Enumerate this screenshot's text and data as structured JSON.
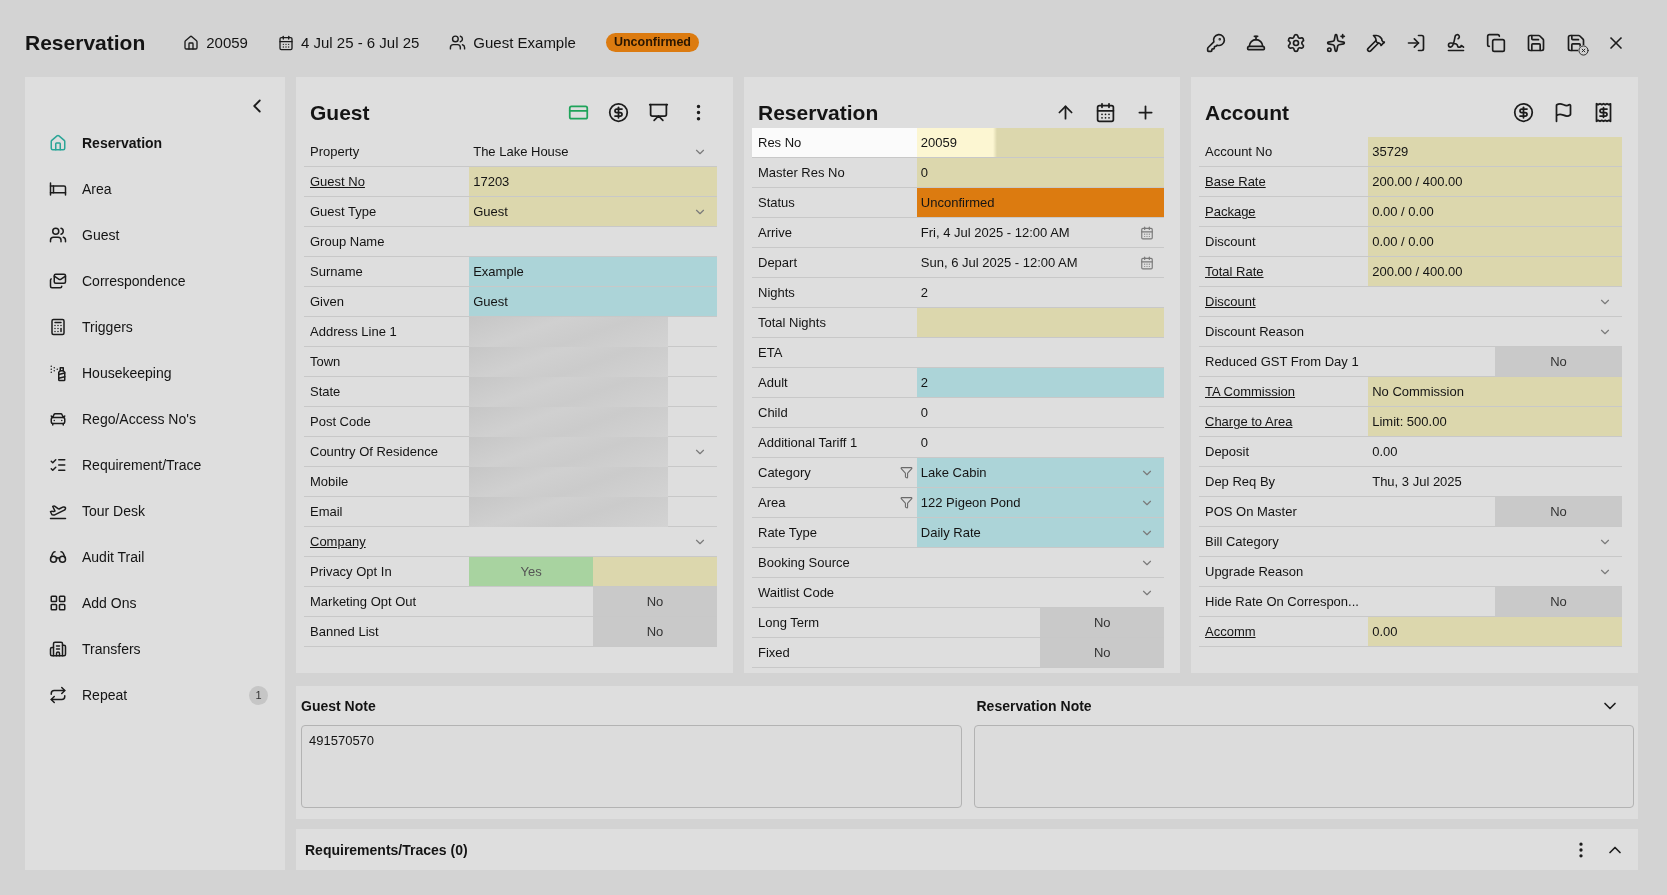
{
  "header": {
    "title": "Reservation",
    "reservation_no": "20059",
    "dates": "4 Jul 25 - 6 Jul 25",
    "guest": "Guest Example",
    "status": "Unconfirmed"
  },
  "sidebar": {
    "items": [
      {
        "label": "Reservation",
        "selected": true
      },
      {
        "label": "Area",
        "selected": false
      },
      {
        "label": "Guest",
        "selected": false
      },
      {
        "label": "Correspondence",
        "selected": false
      },
      {
        "label": "Triggers",
        "selected": false
      },
      {
        "label": "Housekeeping",
        "selected": false
      },
      {
        "label": "Rego/Access No's",
        "selected": false
      },
      {
        "label": "Requirement/Trace",
        "selected": false
      },
      {
        "label": "Tour Desk",
        "selected": false
      },
      {
        "label": "Audit Trail",
        "selected": false
      },
      {
        "label": "Add Ons",
        "selected": false
      },
      {
        "label": "Transfers",
        "selected": false
      },
      {
        "label": "Repeat",
        "selected": false,
        "badge": "1"
      }
    ]
  },
  "panels": [
    {
      "title": "Guest",
      "rows": [
        {
          "kind": "select",
          "label": "Property",
          "link": false,
          "value": "The Lake House"
        },
        {
          "kind": "text",
          "label": "Guest No",
          "link": true,
          "value": "17203",
          "color": "#dcd7ad"
        },
        {
          "kind": "select",
          "label": "Guest Type",
          "link": false,
          "value": "Guest",
          "color": "#dcd7ad"
        },
        {
          "kind": "text",
          "label": "Group Name",
          "link": false
        },
        {
          "kind": "text",
          "label": "Surname",
          "link": false,
          "value": "Example",
          "color": "#acd4d8"
        },
        {
          "kind": "text",
          "label": "Given",
          "link": false,
          "value": "Guest",
          "color": "#acd4d8"
        },
        {
          "kind": "text",
          "label": "Address Line 1",
          "link": false,
          "redacted": true
        },
        {
          "kind": "text",
          "label": "Town",
          "link": false,
          "redacted": true
        },
        {
          "kind": "text",
          "label": "State",
          "link": false,
          "redacted": true
        },
        {
          "kind": "text",
          "label": "Post Code",
          "link": false,
          "redacted": true
        },
        {
          "kind": "select",
          "label": "Country Of Residence",
          "link": false,
          "redacted": true
        },
        {
          "kind": "text",
          "label": "Mobile",
          "link": false,
          "redacted": true
        },
        {
          "kind": "text",
          "label": "Email",
          "link": false,
          "redacted": true
        },
        {
          "kind": "select",
          "label": "Company",
          "link": true
        },
        {
          "kind": "toggle",
          "label": "Privacy Opt In",
          "link": false,
          "on": true,
          "value": "Yes",
          "color": "#dcd7ad"
        },
        {
          "kind": "toggle",
          "label": "Marketing Opt Out",
          "link": false,
          "on": false,
          "value": "No"
        },
        {
          "kind": "toggle",
          "label": "Banned List",
          "link": false,
          "on": false,
          "value": "No"
        }
      ]
    },
    {
      "title": "Reservation",
      "rows": [
        {
          "kind": "text",
          "label": "Res No",
          "link": false,
          "value": "20059",
          "color": "#dcd7ad",
          "highlighted": true
        },
        {
          "kind": "text",
          "label": "Master Res No",
          "link": false,
          "value": "0",
          "color": "#dcd7ad"
        },
        {
          "kind": "text",
          "label": "Status",
          "link": false,
          "value": "Unconfirmed",
          "color": "#dc7b10"
        },
        {
          "kind": "date",
          "label": "Arrive",
          "link": false,
          "value": "Fri, 4 Jul 2025 - 12:00 AM"
        },
        {
          "kind": "date",
          "label": "Depart",
          "link": false,
          "value": "Sun, 6 Jul 2025 - 12:00 AM"
        },
        {
          "kind": "text",
          "label": "Nights",
          "link": false,
          "value": "2"
        },
        {
          "kind": "text",
          "label": "Total Nights",
          "link": false,
          "color": "#dcd7ad"
        },
        {
          "kind": "text",
          "label": "ETA",
          "link": false
        },
        {
          "kind": "text",
          "label": "Adult",
          "link": false,
          "value": "2",
          "color": "#acd4d8"
        },
        {
          "kind": "text",
          "label": "Child",
          "link": false,
          "value": "0"
        },
        {
          "kind": "text",
          "label": "Additional Tariff 1",
          "link": false,
          "value": "0"
        },
        {
          "kind": "select",
          "label": "Category",
          "link": false,
          "filter": true,
          "value": "Lake Cabin",
          "color": "#acd4d8"
        },
        {
          "kind": "select",
          "label": "Area",
          "link": false,
          "filter": true,
          "value": "122 Pigeon Pond",
          "color": "#acd4d8"
        },
        {
          "kind": "select",
          "label": "Rate Type",
          "link": false,
          "value": "Daily Rate",
          "color": "#acd4d8"
        },
        {
          "kind": "select",
          "label": "Booking Source",
          "link": false
        },
        {
          "kind": "select",
          "label": "Waitlist Code",
          "link": false
        },
        {
          "kind": "toggle",
          "label": "Long Term",
          "link": false,
          "on": false,
          "value": "No"
        },
        {
          "kind": "toggle",
          "label": "Fixed",
          "link": false,
          "on": false,
          "value": "No"
        }
      ]
    },
    {
      "title": "Account",
      "rows": [
        {
          "kind": "text",
          "label": "Account No",
          "link": false,
          "value": "35729",
          "color": "#dcd7ad"
        },
        {
          "kind": "text",
          "label": "Base Rate",
          "link": true,
          "value": "200.00 / 400.00",
          "color": "#dcd7ad"
        },
        {
          "kind": "text",
          "label": "Package",
          "link": true,
          "value": "0.00 / 0.00",
          "color": "#dcd7ad"
        },
        {
          "kind": "text",
          "label": "Discount",
          "link": false,
          "value": "0.00 / 0.00",
          "color": "#dcd7ad"
        },
        {
          "kind": "text",
          "label": "Total Rate",
          "link": true,
          "value": "200.00 / 400.00",
          "color": "#dcd7ad"
        },
        {
          "kind": "select",
          "label": "Discount",
          "link": true
        },
        {
          "kind": "select",
          "label": "Discount Reason",
          "link": false
        },
        {
          "kind": "toggle",
          "label": "Reduced GST From Day 1",
          "link": false,
          "on": false,
          "value": "No"
        },
        {
          "kind": "text",
          "label": "TA Commission",
          "link": true,
          "value": "No Commission",
          "color": "#dcd7ad"
        },
        {
          "kind": "text",
          "label": "Charge to Area",
          "link": true,
          "value": "Limit: 500.00",
          "color": "#dcd7ad"
        },
        {
          "kind": "text",
          "label": "Deposit",
          "link": false,
          "value": "0.00"
        },
        {
          "kind": "text",
          "label": "Dep Req By",
          "link": false,
          "value": "Thu, 3 Jul 2025"
        },
        {
          "kind": "toggle",
          "label": "POS On Master",
          "link": false,
          "on": false,
          "value": "No"
        },
        {
          "kind": "select",
          "label": "Bill Category",
          "link": false
        },
        {
          "kind": "select",
          "label": "Upgrade Reason",
          "link": false
        },
        {
          "kind": "toggle",
          "label": "Hide Rate On Correspon...",
          "link": false,
          "on": false,
          "value": "No"
        },
        {
          "kind": "text",
          "label": "Accomm",
          "link": true,
          "value": "0.00",
          "color": "#dcd7ad"
        }
      ]
    }
  ],
  "notes": {
    "expanded": true,
    "guest_note": {
      "label": "Guest Note",
      "value": "491570570"
    },
    "reservation_note": {
      "label": "Reservation Note"
    }
  },
  "requirements": {
    "title": "Requirements/Traces (0)",
    "expanded": false
  }
}
